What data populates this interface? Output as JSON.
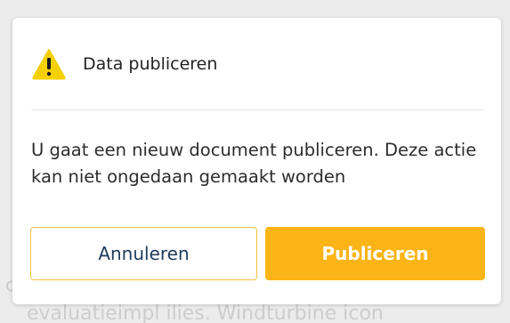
{
  "background": {
    "line_1": "c",
    "line_2": "evaluatieimpl ilies. Windturbine icon"
  },
  "dialog": {
    "title": "Data publiceren",
    "icon": "warning-icon",
    "message": "U gaat een nieuw document publiceren. Deze actie kan niet ongedaan gemaakt worden",
    "cancel_label": "Annuleren",
    "confirm_label": "Publiceren"
  },
  "colors": {
    "accent": "#fbb416",
    "warning_icon": "#f5d000",
    "cancel_text": "#1f3b5a",
    "cancel_border": "#f2c13e"
  }
}
